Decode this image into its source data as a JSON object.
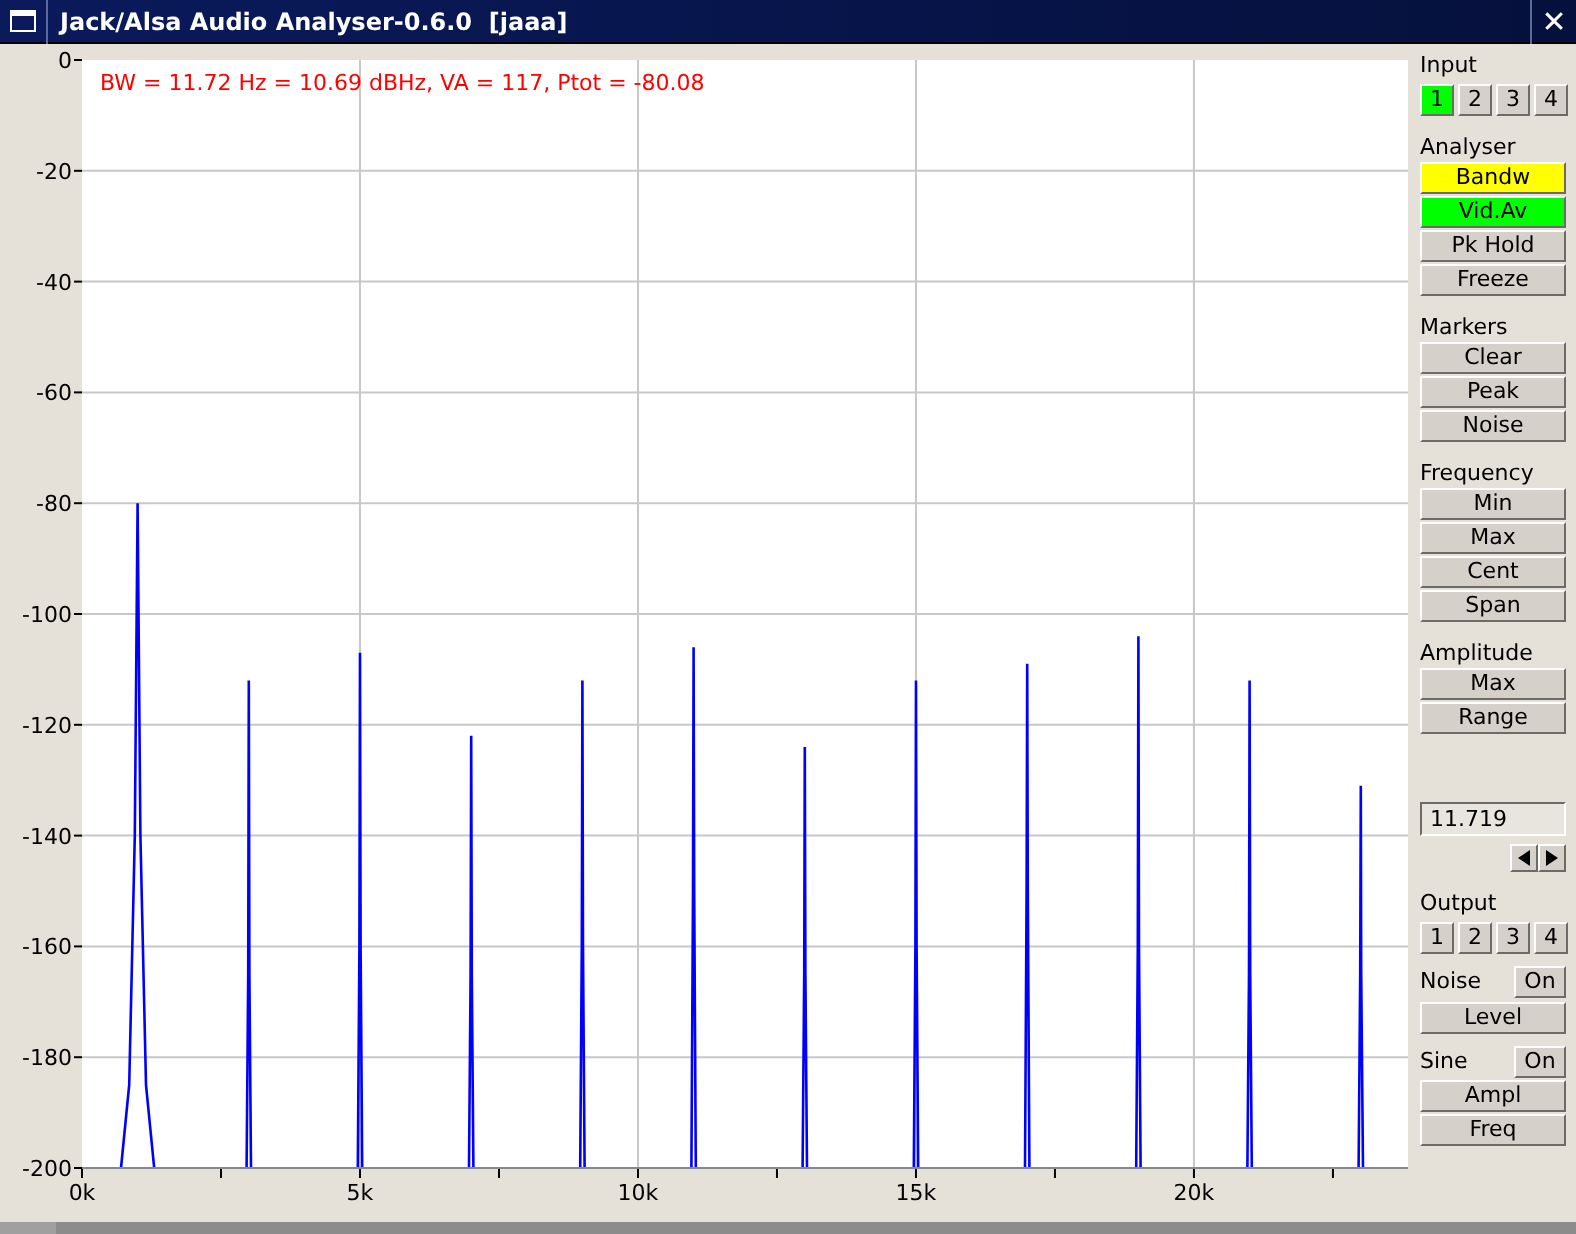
{
  "window": {
    "title": "Jack/Alsa Audio Analyser-0.6.0  [jaaa]",
    "close": "✕"
  },
  "readout": "BW = 11.72 Hz = 10.69 dBHz, VA = 117, Ptot = -80.08",
  "chart_data": {
    "type": "line",
    "xlim": [
      0,
      23850
    ],
    "ylim": [
      -200,
      0
    ],
    "xticks": [
      {
        "value": 0,
        "label": "0k"
      },
      {
        "value": 5000,
        "label": "5k"
      },
      {
        "value": 10000,
        "label": "10k"
      },
      {
        "value": 15000,
        "label": "15k"
      },
      {
        "value": 20000,
        "label": "20k"
      }
    ],
    "grid": true,
    "yticks": [
      0,
      -20,
      -40,
      -60,
      -80,
      -100,
      -120,
      -140,
      -160,
      -180,
      -200
    ],
    "x": [
      700,
      850,
      950,
      1000,
      1050,
      1150,
      1300,
      2960,
      2990,
      3000,
      3010,
      3040,
      4960,
      4990,
      5000,
      5010,
      5040,
      6960,
      6990,
      7000,
      7010,
      7040,
      8960,
      8990,
      9000,
      9010,
      9040,
      10960,
      10990,
      11000,
      11010,
      11040,
      12960,
      12990,
      13000,
      13010,
      13040,
      14960,
      14990,
      15000,
      15010,
      15040,
      16960,
      16990,
      17000,
      17010,
      17040,
      18960,
      18990,
      19000,
      19010,
      19040,
      20960,
      20990,
      21000,
      21010,
      21040,
      22960,
      22990,
      23000,
      23010,
      23040
    ],
    "series": [
      {
        "color": "#0000ff",
        "values": [
          -200,
          -185,
          -140,
          -80,
          -140,
          -185,
          -200,
          -200,
          -165,
          -112,
          -165,
          -200,
          -200,
          -160,
          -107,
          -160,
          -200,
          -200,
          -165,
          -122,
          -165,
          -200,
          -200,
          -160,
          -112,
          -160,
          -200,
          -200,
          -150,
          -106,
          -150,
          -200,
          -200,
          -165,
          -124,
          -165,
          -200,
          -200,
          -160,
          -112,
          -160,
          -200,
          -200,
          -150,
          -109,
          -150,
          -200,
          -200,
          -160,
          -104,
          -160,
          -200,
          -200,
          -165,
          -112,
          -165,
          -200,
          -200,
          -165,
          -131,
          -165,
          -200
        ]
      }
    ]
  },
  "controls": [
    {
      "kind": "heading",
      "label": "Input"
    },
    {
      "kind": "selector",
      "options": [
        {
          "label": "1",
          "selected": true
        },
        {
          "label": "2",
          "selected": false
        },
        {
          "label": "3",
          "selected": false
        },
        {
          "label": "4",
          "selected": false
        }
      ]
    },
    {
      "kind": "heading",
      "label": "Analyser"
    },
    {
      "kind": "button",
      "label": "Bandw",
      "color": "#ffff00"
    },
    {
      "kind": "button",
      "label": "Vid.Av",
      "color": "#00ff00"
    },
    {
      "kind": "button",
      "label": "Pk Hold",
      "color": "#d6d0cb"
    },
    {
      "kind": "button",
      "label": "Freeze",
      "color": "#d6d0cb"
    },
    {
      "kind": "heading",
      "label": "Markers"
    },
    {
      "kind": "button",
      "label": "Clear",
      "color": "#d6d0cb"
    },
    {
      "kind": "button",
      "label": "Peak",
      "color": "#d6d0cb"
    },
    {
      "kind": "button",
      "label": "Noise",
      "color": "#d6d0cb"
    },
    {
      "kind": "heading",
      "label": "Frequency"
    },
    {
      "kind": "button",
      "label": "Min",
      "color": "#d6d0cb"
    },
    {
      "kind": "button",
      "label": "Max",
      "color": "#d6d0cb"
    },
    {
      "kind": "button",
      "label": "Cent",
      "color": "#d6d0cb"
    },
    {
      "kind": "button",
      "label": "Span",
      "color": "#d6d0cb"
    },
    {
      "kind": "heading",
      "label": "Amplitude"
    },
    {
      "kind": "button",
      "label": "Max",
      "color": "#d6d0cb"
    },
    {
      "kind": "button",
      "label": "Range",
      "color": "#d6d0cb"
    },
    {
      "kind": "field",
      "value": "11.719"
    },
    {
      "kind": "stepper"
    },
    {
      "kind": "heading",
      "label": "Output"
    },
    {
      "kind": "selector",
      "options": [
        {
          "label": "1",
          "selected": false
        },
        {
          "label": "2",
          "selected": false
        },
        {
          "label": "3",
          "selected": false
        },
        {
          "label": "4",
          "selected": false
        }
      ]
    },
    {
      "kind": "toggle",
      "label": "Noise",
      "button": "On",
      "on": false
    },
    {
      "kind": "button",
      "label": "Level",
      "color": "#d6d0cb"
    },
    {
      "kind": "toggle",
      "label": "Sine",
      "button": "On",
      "on": false
    },
    {
      "kind": "button",
      "label": "Ampl",
      "color": "#d6d0cb"
    },
    {
      "kind": "button",
      "label": "Freq",
      "color": "#d6d0cb"
    }
  ]
}
